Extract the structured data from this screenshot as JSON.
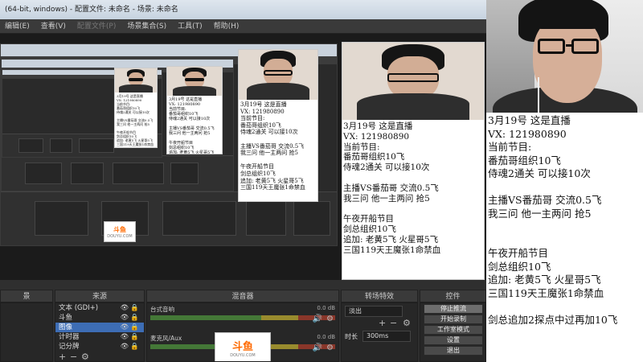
{
  "obs": {
    "title": "(64-bit, windows) - 配置文件: 未命名 - 场景: 未命名",
    "menu": [
      {
        "label": "编辑(E)",
        "dim": false
      },
      {
        "label": "查看(V)",
        "dim": false
      },
      {
        "label": "配置文件(P)",
        "dim": true
      },
      {
        "label": "场景集合(S)",
        "dim": false
      },
      {
        "label": "工具(T)",
        "dim": false
      },
      {
        "label": "帮助(H)",
        "dim": false
      }
    ],
    "docks": {
      "scenes_header": "景",
      "sources_header": "来源",
      "mixer_header": "混音器",
      "transitions_header": "转场特效",
      "controls_header": "控件"
    },
    "sources": [
      {
        "label": "文本 (GDI+)",
        "selected": false
      },
      {
        "label": "斗鱼",
        "selected": false
      },
      {
        "label": "图像",
        "selected": true
      },
      {
        "label": "计时器",
        "selected": false
      },
      {
        "label": "记分牌",
        "selected": false
      }
    ],
    "mixer": [
      {
        "name": "台式音响",
        "db": "0.0 dB"
      },
      {
        "name": "麦克风/Aux",
        "db": "0.0 dB"
      }
    ],
    "transition": {
      "type": "淡出",
      "duration_label": "时长",
      "duration_value": "300ms"
    },
    "controls": [
      "停止推流",
      "开始录制",
      "工作室模式",
      "设置",
      "退出"
    ]
  },
  "douyu": {
    "name": "斗鱼",
    "domain": "DOUYU.COM"
  },
  "announcement": {
    "lines_mini": "3月19号 这是直播\nVX: 121980890\n当前节目:\n番茄哥组织10飞\n侍魂2通关 可以接10次\n\n主播VS番茄哥 交流0.5飞\n我三问 他一主两问 抢5\n\n午夜开船节目\n剑总组织10飞\n追加: 老黄5飞 火星哥5飞\n三国119天王魔张1命禁血",
    "lines": "3月19号 这是直播\nVX: 121980890\n当前节目:\n番茄哥组织10飞\n侍魂2通关 可以接10次\n\n主播VS番茄哥 交流0.5飞\n我三问 他一主两问 抢5\n\n\n午夜开船节目\n剑总组织10飞\n追加: 老黄5飞 火星哥5飞\n三国119天王魔张1命禁血\n\n剑总追加2探点中过再加10飞"
  }
}
